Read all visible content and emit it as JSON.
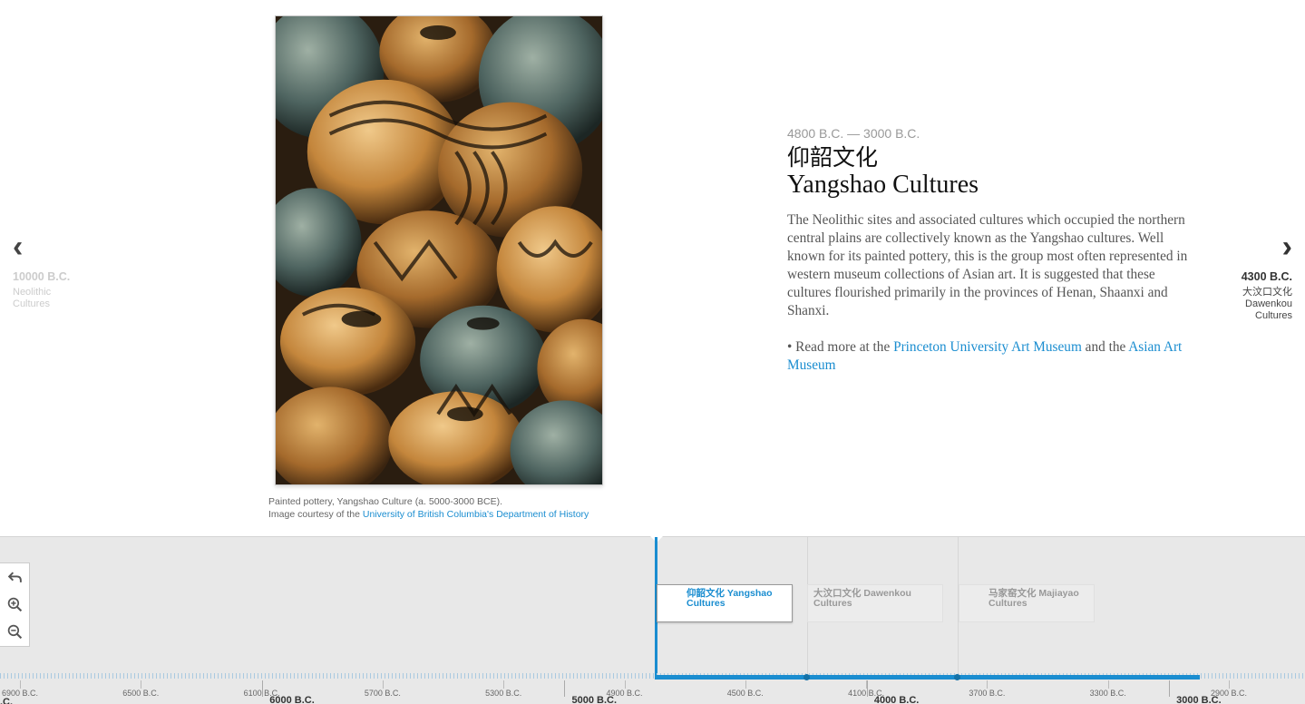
{
  "slide": {
    "dates": "4800 B.C. — 3000 B.C.",
    "title_zh": "仰韶文化",
    "title_en": "Yangshao Cultures",
    "body": "The Neolithic sites and associated cultures which occupied the northern central plains are collectively known as the Yangshao cultures. Well known for its painted pottery, this is the group most often represented in western museum collections of Asian art. It is suggested that these cultures flourished primarily in the provinces of Henan, Shaanxi and Shanxi.",
    "readmore_prefix": "• Read more at the ",
    "readmore_link1": "Princeton University Art Museum",
    "readmore_mid": " and the ",
    "readmore_link2": "Asian Art Museum",
    "caption_line1": "Painted pottery, Yangshao Culture (a. 5000-3000 BCE).",
    "caption_prefix": "Image courtesy of the ",
    "caption_link": "University of British Columbia's Department of History"
  },
  "nav": {
    "prev": {
      "date": "10000 B.C.",
      "line1": "Neolithic",
      "line2": "Cultures"
    },
    "next": {
      "date": "4300 B.C.",
      "line1": "大汶口文化",
      "line2": "Dawenkou",
      "line3": "Cultures"
    }
  },
  "timeline": {
    "flags": [
      {
        "label": "仰韶文化 Yangshao Cultures",
        "active": true
      },
      {
        "label": "大汶口文化 Dawenkou Cultures",
        "active": false
      },
      {
        "label": "马家窑文化 Majiayao Cultures",
        "active": false
      }
    ],
    "minor_ticks": [
      "6900 B.C.",
      "6500 B.C.",
      "6100 B.C.",
      "5700 B.C.",
      "5300 B.C.",
      "4900 B.C.",
      "4500 B.C.",
      "4100 B.C.",
      "3700 B.C.",
      "3300 B.C.",
      "2900 B.C."
    ],
    "major_ticks": [
      "6000 B.C.",
      "5000 B.C.",
      "4000 B.C.",
      "3000 B.C."
    ],
    "edge_fragment": ".C."
  },
  "controls": {
    "back_icon": "back-arrow-icon",
    "zoom_in_icon": "zoom-in-icon",
    "zoom_out_icon": "zoom-out-icon"
  },
  "colors": {
    "accent": "#1a8dd0",
    "timeline_bg": "#e8e8e8"
  }
}
